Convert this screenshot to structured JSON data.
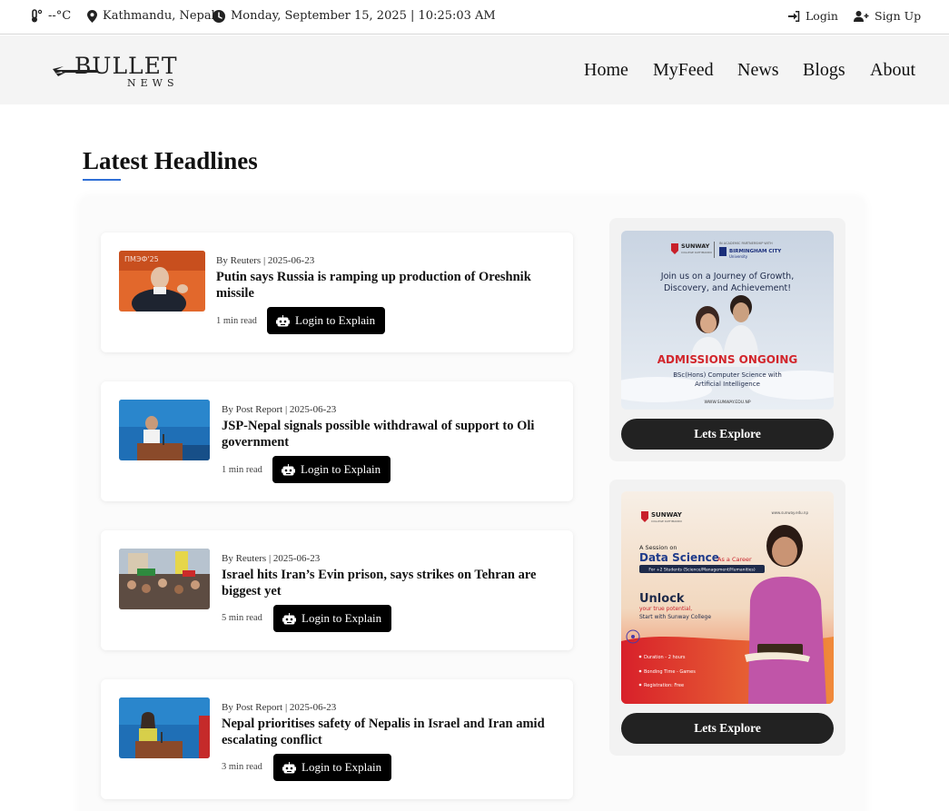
{
  "topbar": {
    "weather": "--°C",
    "location": "Kathmandu, Nepal",
    "datetime": "Monday, September 15, 2025 | 10:25:03 AM",
    "login_label": "Login",
    "signup_label": "Sign Up",
    "icons": [
      "thermometer-icon",
      "map-pin-icon",
      "clock-icon",
      "sign-in-icon",
      "user-plus-icon"
    ]
  },
  "brand": {
    "logo_top": "BULLET",
    "logo_bottom": "NEWS"
  },
  "nav": {
    "items": [
      "Home",
      "MyFeed",
      "News",
      "Blogs",
      "About"
    ]
  },
  "section": {
    "title": "Latest Headlines",
    "accent_color": "#2f6fd6"
  },
  "articles": [
    {
      "meta": "By Reuters | 2025-06-23",
      "title": "Putin says Russia is ramping up production of Oreshnik missile",
      "read_time": "1 min read",
      "button_label": "Login to Explain"
    },
    {
      "meta": "By Post Report | 2025-06-23",
      "title": "JSP-Nepal signals possible withdrawal of support to Oli government",
      "read_time": "1 min read",
      "button_label": "Login to Explain"
    },
    {
      "meta": "By Reuters | 2025-06-23",
      "title": "Israel hits Iran’s Evin prison, says strikes on Tehran are biggest yet",
      "read_time": "5 min read",
      "button_label": "Login to Explain"
    },
    {
      "meta": "By Post Report | 2025-06-23",
      "title": "Nepal prioritises safety of Nepalis in Israel and Iran amid escalating conflict",
      "read_time": "3 min read",
      "button_label": "Login to Explain"
    }
  ],
  "ads": [
    {
      "brand": "SUNWAY",
      "brand_sub": "COLLEGE KATHMANDU",
      "partner": "BIRMINGHAM CITY",
      "partner_sub": "University",
      "partner_tag": "IN ACADEMIC PARTNERSHIP WITH",
      "tagline_1": "Join us on a Journey of Growth,",
      "tagline_2": "Discovery, and Achievement!",
      "headline": "ADMISSIONS ONGOING",
      "program_1": "BSc(Hons) Computer Science with",
      "program_2": "Artificial Intelligence",
      "url": "WWW.SUNWAY.EDU.NP",
      "button_label": "Lets Explore"
    },
    {
      "brand": "SUNWAY",
      "brand_sub": "COLLEGE KATHMANDU",
      "url": "www.sunway.edu.np",
      "line_1": "A Session on",
      "headline": "Data Science",
      "headline_suffix": "As a Career",
      "audience": "For +2 Students (Science/Management/Humanities)",
      "unlock": "Unlock",
      "unlock_1": "your true potential,",
      "unlock_2": "Start with Sunway College",
      "bullet_1": "Duration - 2 hours",
      "bullet_2": "Bonding Time - Games",
      "bullet_3": "Registration: Free",
      "button_label": "Lets Explore"
    }
  ]
}
